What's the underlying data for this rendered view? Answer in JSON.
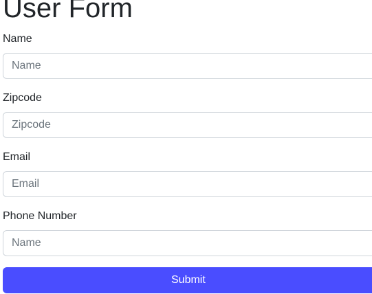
{
  "form": {
    "title": "User Form",
    "fields": [
      {
        "label": "Name",
        "placeholder": "Name",
        "value": ""
      },
      {
        "label": "Zipcode",
        "placeholder": "Zipcode",
        "value": ""
      },
      {
        "label": "Email",
        "placeholder": "Email",
        "value": ""
      },
      {
        "label": "Phone Number",
        "placeholder": "Name",
        "value": ""
      }
    ],
    "submit_label": "Submit"
  },
  "colors": {
    "primary_button": "#4a4dff",
    "input_border": "#ced4da",
    "placeholder_text": "#6c757d",
    "body_text": "#212529"
  }
}
